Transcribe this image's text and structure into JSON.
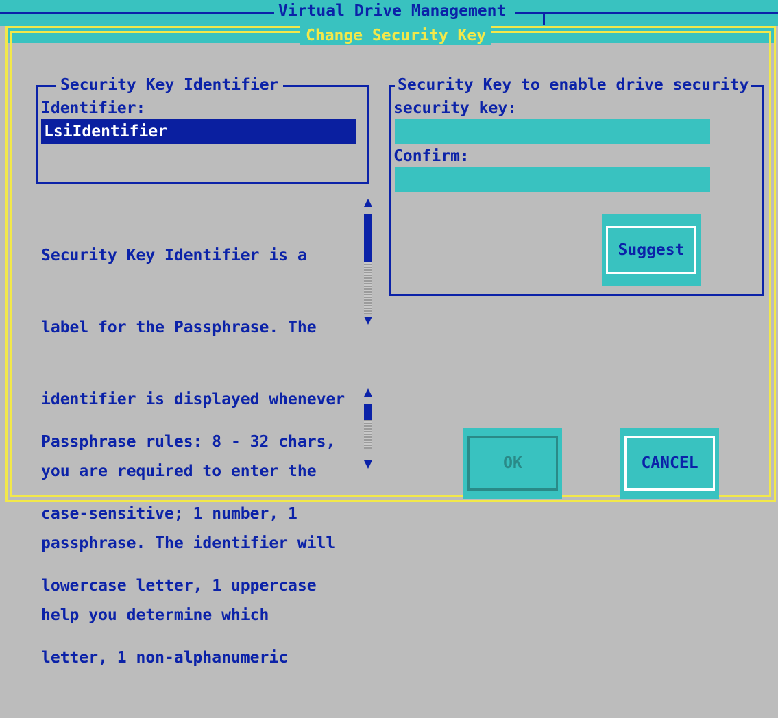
{
  "header": {
    "title": "Virtual Drive Management"
  },
  "dialog": {
    "title": "Change Security Key",
    "identifier_group": {
      "legend": "Security Key Identifier",
      "label": "Identifier:",
      "value": "LsiIdentifier"
    },
    "key_group": {
      "legend": "Security Key to enable drive security",
      "security_key_label": "security key:",
      "security_key_value": "",
      "confirm_label": "Confirm:",
      "confirm_value": "",
      "suggest_label": "Suggest"
    },
    "help_text": {
      "lines": [
        "Security Key Identifier is a",
        "label for the Passphrase. The",
        "identifier is displayed whenever",
        "you are required to enter the",
        "passphrase. The identifier will",
        "help you determine which"
      ]
    },
    "rules_text": {
      "lines": [
        "Passphrase rules: 8 - 32 chars,",
        "case-sensitive; 1 number, 1",
        "lowercase letter, 1 uppercase",
        "letter, 1 non-alphanumeric"
      ]
    },
    "buttons": {
      "ok_label": "OK",
      "cancel_label": "CANCEL",
      "ok_enabled": false
    },
    "colors": {
      "background": "#bcbcbc",
      "text": "#0b22a8",
      "accent_cyan": "#39c2c0",
      "frame_yellow": "#f2e84a",
      "selected_field": "#0a1fa0"
    }
  }
}
